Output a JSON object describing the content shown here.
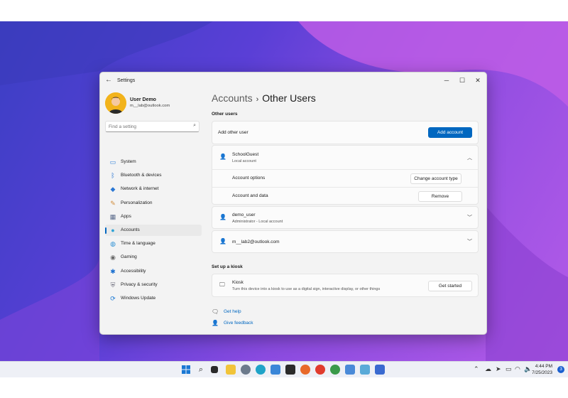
{
  "window": {
    "app_title": "Settings",
    "back_icon": "back-arrow-icon",
    "controls": {
      "minimize": "─",
      "maximize": "☐",
      "close": "✕"
    }
  },
  "user": {
    "name": "User Demo",
    "email": "m__lab@outlook.com"
  },
  "search": {
    "placeholder": "Find a setting"
  },
  "nav": [
    {
      "label": "System",
      "icon": "monitor-icon",
      "color": "#2f7fd8"
    },
    {
      "label": "Bluetooth & devices",
      "icon": "bluetooth-icon",
      "color": "#1f6fd0"
    },
    {
      "label": "Network & internet",
      "icon": "wifi-icon",
      "color": "#2a77d4"
    },
    {
      "label": "Personalization",
      "icon": "brush-icon",
      "color": "#d08a3a"
    },
    {
      "label": "Apps",
      "icon": "apps-icon",
      "color": "#5a6a8a"
    },
    {
      "label": "Accounts",
      "icon": "person-icon",
      "color": "#2ea3d6",
      "active": true
    },
    {
      "label": "Time & language",
      "icon": "globe-icon",
      "color": "#2a8fd4"
    },
    {
      "label": "Gaming",
      "icon": "gamepad-icon",
      "color": "#6a6a6a"
    },
    {
      "label": "Accessibility",
      "icon": "accessibility-icon",
      "color": "#1a6fd0"
    },
    {
      "label": "Privacy & security",
      "icon": "shield-icon",
      "color": "#6a6a7a"
    },
    {
      "label": "Windows Update",
      "icon": "update-icon",
      "color": "#1a78d4"
    }
  ],
  "breadcrumb": {
    "parent": "Accounts",
    "separator": "›",
    "current": "Other Users"
  },
  "other_users": {
    "heading": "Other users",
    "add_label": "Add other user",
    "add_button": "Add account",
    "accounts": [
      {
        "name": "SchoolGuest",
        "type": "Local account",
        "expanded": true,
        "options": [
          {
            "label": "Account options",
            "button": "Change account type"
          },
          {
            "label": "Account and data",
            "button": "Remove"
          }
        ]
      },
      {
        "name": "demo_user",
        "type": "Administrator - Local account",
        "expanded": false
      },
      {
        "name": "m__lab2@outlook.com",
        "type": "",
        "expanded": false
      }
    ]
  },
  "kiosk": {
    "heading": "Set up a kiosk",
    "title": "Kiosk",
    "description": "Turn this device into a kiosk to use as a digital sign, interactive display, or other things",
    "button": "Get started"
  },
  "links": {
    "help": "Get help",
    "feedback": "Give feedback"
  },
  "taskbar": {
    "time": "4:44 PM",
    "date": "7/25/2023",
    "notifications": "3"
  },
  "colors": {
    "accent": "#0067c0"
  }
}
